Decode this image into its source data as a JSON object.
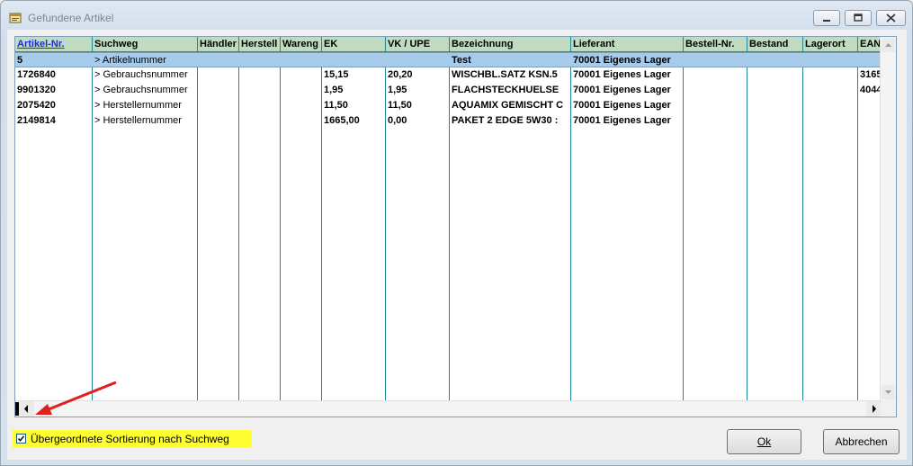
{
  "window": {
    "title": "Gefundene Artikel"
  },
  "columns": [
    "Artikel-Nr.",
    "Suchweg",
    "Händler",
    "Herstell",
    "Wareng",
    "EK",
    "VK / UPE",
    "Bezeichnung",
    "Lieferant",
    "Bestell-Nr.",
    "Bestand",
    "Lagerort",
    "EAN"
  ],
  "rows": [
    {
      "artikel": "5",
      "suchweg": "> Artikelnummer",
      "haendler": "",
      "herstell": "",
      "wareng": "",
      "ek": "",
      "vk": "",
      "bezeichnung": "Test",
      "lieferant": "70001 Eigenes Lager",
      "bestellnr": "",
      "bestand": "",
      "lagerort": "",
      "ean": ""
    },
    {
      "artikel": "1726840",
      "suchweg": "> Gebrauchsnummer",
      "haendler": "",
      "herstell": "",
      "wareng": "",
      "ek": "15,15",
      "vk": "20,20",
      "bezeichnung": "WISCHBL.SATZ KSN.5",
      "lieferant": "70001 Eigenes Lager",
      "bestellnr": "",
      "bestand": "",
      "lagerort": "",
      "ean": "3165"
    },
    {
      "artikel": "9901320",
      "suchweg": "> Gebrauchsnummer",
      "haendler": "",
      "herstell": "",
      "wareng": "",
      "ek": "1,95",
      "vk": "1,95",
      "bezeichnung": "FLACHSTECKHUELSE",
      "lieferant": "70001 Eigenes Lager",
      "bestellnr": "",
      "bestand": "",
      "lagerort": "",
      "ean": "4044"
    },
    {
      "artikel": "2075420",
      "suchweg": "> Herstellernummer",
      "haendler": "",
      "herstell": "",
      "wareng": "",
      "ek": "11,50",
      "vk": "11,50",
      "bezeichnung": "AQUAMIX GEMISCHT C",
      "lieferant": "70001 Eigenes Lager",
      "bestellnr": "",
      "bestand": "",
      "lagerort": "",
      "ean": ""
    },
    {
      "artikel": "2149814",
      "suchweg": "> Herstellernummer",
      "haendler": "",
      "herstell": "",
      "wareng": "",
      "ek": "1665,00",
      "vk": "0,00",
      "bezeichnung": "PAKET 2 EDGE 5W30 :",
      "lieferant": "70001 Eigenes Lager",
      "bestellnr": "",
      "bestand": "",
      "lagerort": "",
      "ean": ""
    }
  ],
  "options": {
    "sort_label": "Übergeordnete Sortierung nach Suchweg",
    "sort_checked": true
  },
  "buttons": {
    "ok": "Ok",
    "cancel": "Abbrechen"
  },
  "colors": {
    "header_bg": "#c0dcc0",
    "grid_line": "#1e8a98",
    "selected_row": "#a6cbeb",
    "highlight": "#ffff33",
    "annotation_arrow": "#e0201c"
  },
  "icons": {
    "app": "app-window-icon",
    "minimize": "minimize-icon",
    "restore": "restore-icon",
    "close": "close-icon"
  }
}
